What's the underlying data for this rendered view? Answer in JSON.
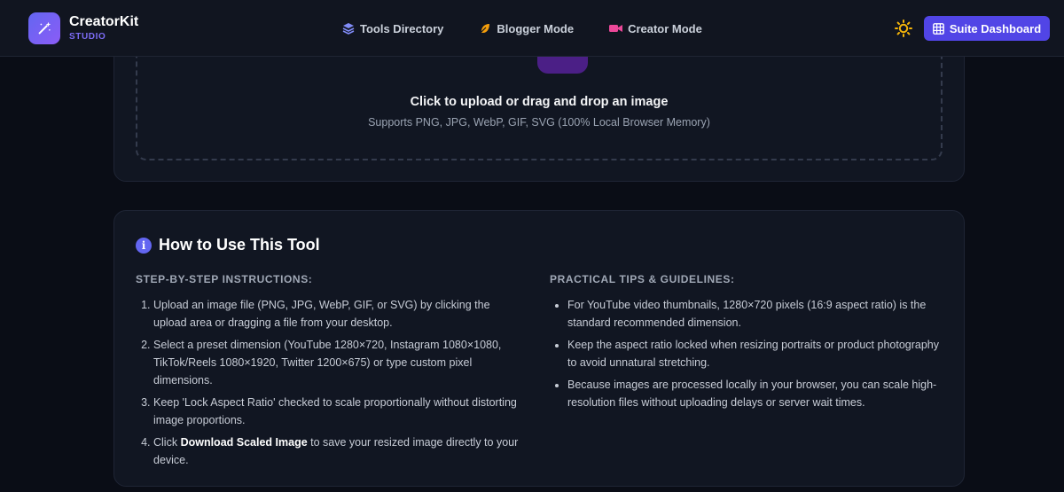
{
  "brand": {
    "name": "CreatorKit",
    "sub": "STUDIO"
  },
  "nav": {
    "links": [
      {
        "label": "Tools Directory",
        "icon": "layers-icon",
        "color": "#818cf8"
      },
      {
        "label": "Blogger Mode",
        "icon": "feather-icon",
        "color": "#f59e0b"
      },
      {
        "label": "Creator Mode",
        "icon": "video-icon",
        "color": "#ec4899"
      }
    ],
    "suite_label": "Suite Dashboard"
  },
  "upload": {
    "title": "Click to upload or drag and drop an image",
    "subtitle": "Supports PNG, JPG, WebP, GIF, SVG (100% Local Browser Memory)"
  },
  "howto": {
    "title": "How to Use This Tool",
    "steps_heading": "STEP-BY-STEP INSTRUCTIONS:",
    "steps": [
      {
        "text": "Upload an image file (PNG, JPG, WebP, GIF, or SVG) by clicking the upload area or dragging a file from your desktop."
      },
      {
        "text": "Select a preset dimension (YouTube 1280×720, Instagram 1080×1080, TikTok/Reels 1080×1920, Twitter 1200×675) or type custom pixel dimensions."
      },
      {
        "text": "Keep 'Lock Aspect Ratio' checked to scale proportionally without distorting image proportions."
      },
      {
        "pre": "Click ",
        "bold": "Download Scaled Image",
        "post": " to save your resized image directly to your device."
      }
    ],
    "tips_heading": "PRACTICAL TIPS & GUIDELINES:",
    "tips": [
      "For YouTube video thumbnails, 1280×720 pixels (16:9 aspect ratio) is the standard recommended dimension.",
      "Keep the aspect ratio locked when resizing portraits or product photography to avoid unnatural stretching.",
      "Because images are processed locally in your browser, you can scale high-resolution files without uploading delays or server wait times."
    ]
  },
  "colors": {
    "accent": "#5145e6",
    "sun": "#f5b50a",
    "background": "#0a0d16"
  }
}
